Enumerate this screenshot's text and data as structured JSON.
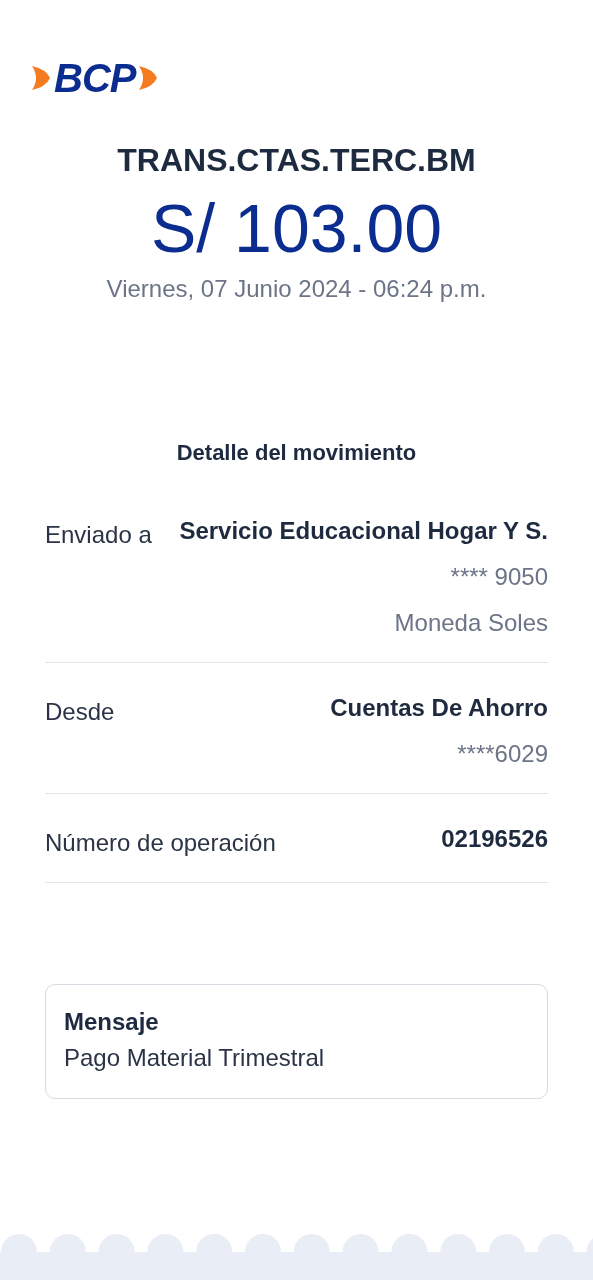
{
  "logo": {
    "text": "BCP"
  },
  "title": "TRANS.CTAS.TERC.BM",
  "amount": "S/ 103.00",
  "date": "Viernes, 07 Junio 2024 - 06:24 p.m.",
  "detail": {
    "heading": "Detalle del movimiento",
    "rows": [
      {
        "label": "Enviado a",
        "values": [
          "Servicio Educacional Hogar Y S.",
          "**** 9050",
          "Moneda Soles"
        ]
      },
      {
        "label": "Desde",
        "values": [
          "Cuentas De Ahorro",
          "****6029"
        ]
      },
      {
        "label": "Número de operación",
        "values": [
          "02196526"
        ]
      }
    ]
  },
  "message": {
    "label": "Mensaje",
    "text": "Pago Material Trimestral"
  }
}
